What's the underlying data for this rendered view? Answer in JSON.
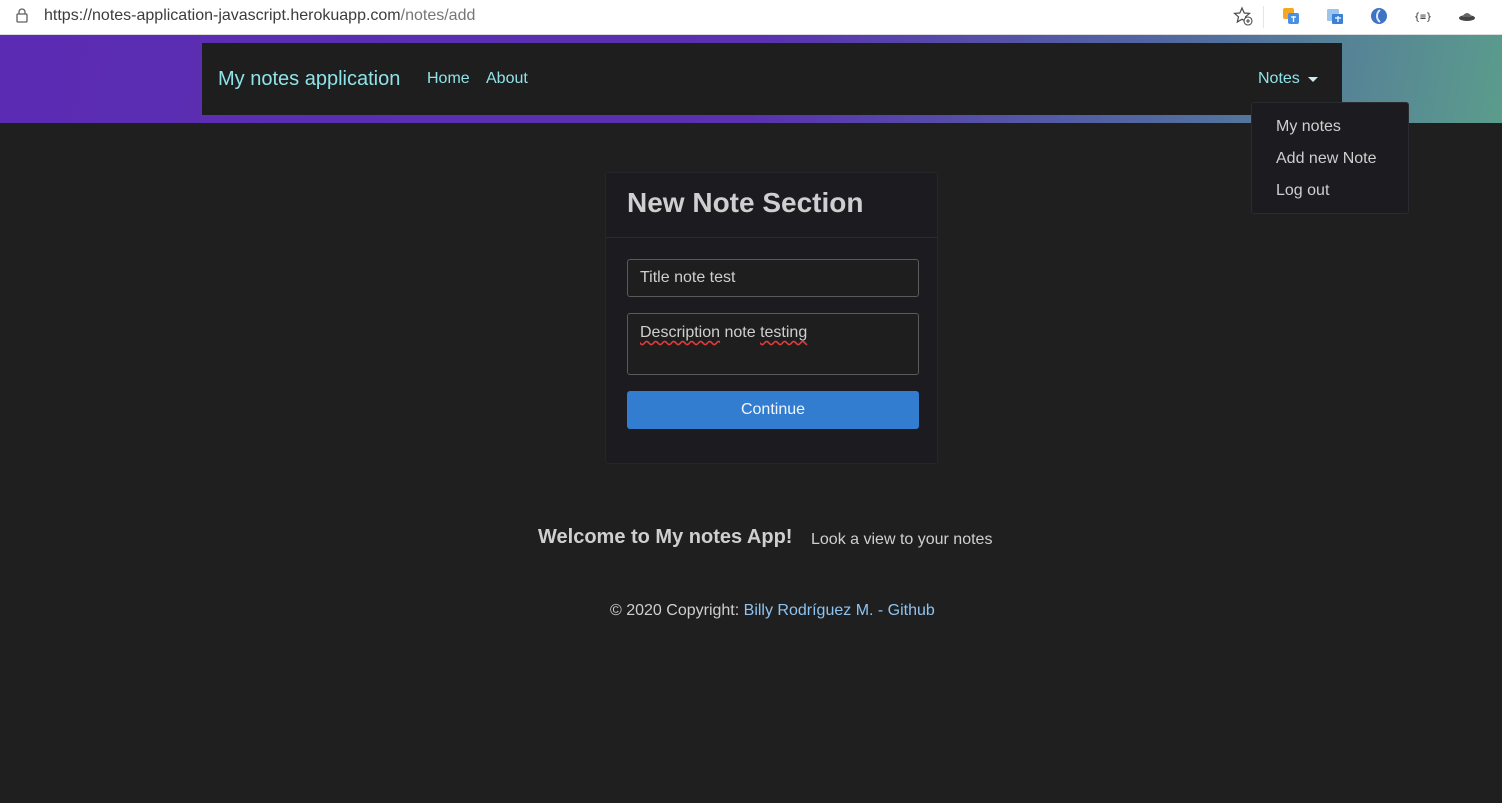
{
  "browser": {
    "url_host": "https://notes-application-javascript.herokuapp.com",
    "url_path": "/notes/add",
    "extension_icons": [
      "translate-icon",
      "image-translate-icon",
      "vpn-icon",
      "json-formatter-icon",
      "ufo-icon"
    ]
  },
  "navbar": {
    "brand": "My notes application",
    "links": [
      "Home",
      "About"
    ],
    "notes_label": "Notes"
  },
  "dropdown": {
    "items": [
      "My notes",
      "Add new Note",
      "Log out"
    ]
  },
  "form": {
    "heading": "New Note Section",
    "title_value": "Title note test",
    "description_words": [
      "Description",
      "note",
      "testing"
    ],
    "submit_label": "Continue"
  },
  "footer": {
    "welcome": "Welcome to My notes App!",
    "tagline": "Look a view to your notes",
    "copyright_prefix": "© 2020 Copyright: ",
    "author": "Billy Rodríguez M. - Github"
  },
  "colors": {
    "link": "#8fe3e8",
    "primary_button": "#337dd1",
    "background": "#1f1f1f",
    "gradient_start": "#5b2cb3",
    "gradient_end": "#5b9c8c"
  }
}
